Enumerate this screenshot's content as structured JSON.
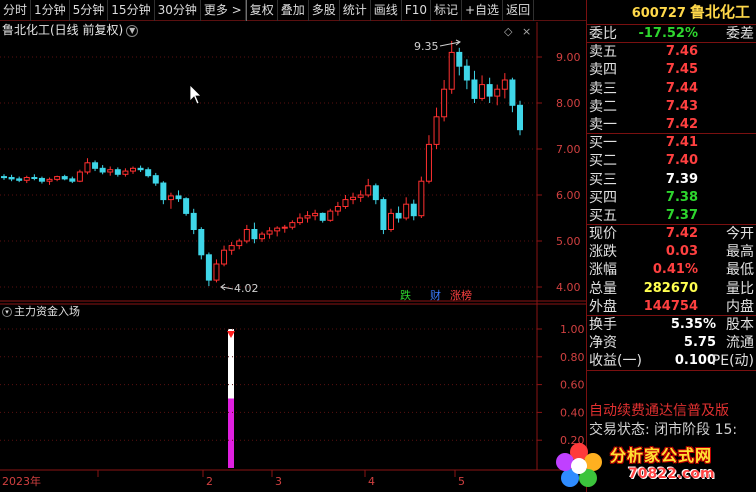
{
  "toolbar": [
    "分时",
    "1分钟",
    "5分钟",
    "15分钟",
    "30分钟",
    "更多 >",
    "复权",
    "叠加",
    "多股",
    "统计",
    "画线",
    "F10",
    "标记",
    "+自选",
    "返回"
  ],
  "chart": {
    "title": "鲁北化工(日线 前复权)",
    "indicator_title": "主力资金入场",
    "high_label": "9.35",
    "low_label": "4.02",
    "year_label": "2023年",
    "month_ticks": [
      "2",
      "3",
      "4",
      "5"
    ],
    "badges": [
      {
        "text": "跌",
        "color": "#2ed62e"
      },
      {
        "text": "财",
        "color": "#3a7cff"
      },
      {
        "text": "涨榜",
        "color": "#ff4040"
      }
    ]
  },
  "chart_data": [
    {
      "type": "candlestick",
      "y_axis_ticks": [
        4.0,
        5.0,
        6.0,
        7.0,
        8.0,
        9.0
      ],
      "ylim": [
        3.95,
        9.55
      ],
      "ohlc": [
        [
          6.4,
          6.45,
          6.33,
          6.38
        ],
        [
          6.38,
          6.44,
          6.3,
          6.35
        ],
        [
          6.35,
          6.4,
          6.28,
          6.32
        ],
        [
          6.32,
          6.42,
          6.26,
          6.38
        ],
        [
          6.38,
          6.45,
          6.32,
          6.36
        ],
        [
          6.36,
          6.4,
          6.25,
          6.3
        ],
        [
          6.3,
          6.38,
          6.22,
          6.34
        ],
        [
          6.34,
          6.42,
          6.3,
          6.4
        ],
        [
          6.4,
          6.44,
          6.32,
          6.35
        ],
        [
          6.35,
          6.4,
          6.26,
          6.3
        ],
        [
          6.3,
          6.55,
          6.28,
          6.5
        ],
        [
          6.5,
          6.8,
          6.45,
          6.7
        ],
        [
          6.7,
          6.75,
          6.52,
          6.58
        ],
        [
          6.58,
          6.65,
          6.45,
          6.5
        ],
        [
          6.5,
          6.62,
          6.42,
          6.55
        ],
        [
          6.55,
          6.6,
          6.4,
          6.45
        ],
        [
          6.45,
          6.58,
          6.4,
          6.52
        ],
        [
          6.52,
          6.62,
          6.46,
          6.58
        ],
        [
          6.58,
          6.64,
          6.5,
          6.55
        ],
        [
          6.55,
          6.6,
          6.38,
          6.42
        ],
        [
          6.42,
          6.48,
          6.2,
          6.26
        ],
        [
          6.26,
          6.3,
          5.8,
          5.9
        ],
        [
          5.9,
          6.05,
          5.7,
          5.98
        ],
        [
          5.98,
          6.1,
          5.85,
          5.92
        ],
        [
          5.92,
          5.95,
          5.55,
          5.6
        ],
        [
          5.6,
          5.7,
          5.15,
          5.25
        ],
        [
          5.25,
          5.3,
          4.6,
          4.7
        ],
        [
          4.7,
          4.75,
          4.02,
          4.15
        ],
        [
          4.15,
          4.6,
          4.1,
          4.5
        ],
        [
          4.5,
          4.9,
          4.45,
          4.8
        ],
        [
          4.8,
          4.98,
          4.7,
          4.9
        ],
        [
          4.9,
          5.05,
          4.82,
          5.0
        ],
        [
          5.0,
          5.35,
          4.95,
          5.25
        ],
        [
          5.25,
          5.4,
          4.95,
          5.05
        ],
        [
          5.05,
          5.2,
          4.98,
          5.15
        ],
        [
          5.15,
          5.3,
          5.05,
          5.22
        ],
        [
          5.22,
          5.32,
          5.1,
          5.28
        ],
        [
          5.28,
          5.35,
          5.18,
          5.3
        ],
        [
          5.3,
          5.45,
          5.25,
          5.4
        ],
        [
          5.4,
          5.6,
          5.35,
          5.5
        ],
        [
          5.5,
          5.65,
          5.4,
          5.55
        ],
        [
          5.55,
          5.68,
          5.45,
          5.6
        ],
        [
          5.6,
          5.62,
          5.4,
          5.45
        ],
        [
          5.45,
          5.7,
          5.42,
          5.65
        ],
        [
          5.65,
          5.85,
          5.55,
          5.75
        ],
        [
          5.75,
          6.0,
          5.7,
          5.9
        ],
        [
          5.9,
          6.05,
          5.8,
          5.95
        ],
        [
          5.95,
          6.1,
          5.85,
          6.0
        ],
        [
          6.0,
          6.35,
          5.95,
          6.2
        ],
        [
          6.2,
          6.25,
          5.8,
          5.9
        ],
        [
          5.9,
          5.95,
          5.15,
          5.25
        ],
        [
          5.25,
          5.7,
          5.2,
          5.6
        ],
        [
          5.6,
          5.75,
          5.4,
          5.5
        ],
        [
          5.5,
          5.95,
          5.45,
          5.8
        ],
        [
          5.8,
          5.9,
          5.45,
          5.55
        ],
        [
          5.55,
          6.4,
          5.5,
          6.3
        ],
        [
          6.3,
          7.3,
          6.25,
          7.1
        ],
        [
          7.1,
          7.9,
          7.0,
          7.7
        ],
        [
          7.7,
          8.5,
          7.6,
          8.3
        ],
        [
          8.3,
          9.35,
          8.2,
          9.1
        ],
        [
          9.1,
          9.2,
          8.6,
          8.8
        ],
        [
          8.8,
          8.95,
          8.3,
          8.5
        ],
        [
          8.5,
          8.7,
          8.0,
          8.1
        ],
        [
          8.1,
          8.6,
          8.05,
          8.4
        ],
        [
          8.4,
          8.55,
          8.0,
          8.15
        ],
        [
          8.15,
          8.4,
          7.95,
          8.3
        ],
        [
          8.3,
          8.65,
          8.1,
          8.5
        ],
        [
          8.5,
          8.55,
          7.8,
          7.95
        ],
        [
          7.95,
          8.05,
          7.3,
          7.42
        ]
      ]
    },
    {
      "type": "bar",
      "series": [
        {
          "values": [
            0.5,
            1.0
          ]
        }
      ],
      "y_axis_ticks": [
        0.2,
        0.4,
        0.6,
        0.8,
        1.0
      ],
      "ylim": [
        0,
        1.05
      ]
    }
  ],
  "panel": {
    "code": "600727",
    "name": "鲁北化工",
    "weibi": {
      "label": "委比",
      "value": "-17.52%",
      "label2": "委差",
      "color": "#2ed62e"
    },
    "asks": [
      {
        "label": "卖五",
        "price": "7.46"
      },
      {
        "label": "卖四",
        "price": "7.45"
      },
      {
        "label": "卖三",
        "price": "7.44"
      },
      {
        "label": "卖二",
        "price": "7.43"
      },
      {
        "label": "卖一",
        "price": "7.42"
      }
    ],
    "bids": [
      {
        "label": "买一",
        "price": "7.41",
        "color": "#ff4040"
      },
      {
        "label": "买二",
        "price": "7.40",
        "color": "#ff4040"
      },
      {
        "label": "买三",
        "price": "7.39",
        "color": "#ffffff"
      },
      {
        "label": "买四",
        "price": "7.38",
        "color": "#2ed62e"
      },
      {
        "label": "买五",
        "price": "7.37",
        "color": "#2ed62e"
      }
    ],
    "quote": [
      {
        "label": "现价",
        "value": "7.42",
        "label2": "今开",
        "color": "#ff4040"
      },
      {
        "label": "涨跌",
        "value": "0.03",
        "label2": "最高",
        "color": "#ff4040"
      },
      {
        "label": "涨幅",
        "value": "0.41%",
        "label2": "最低",
        "color": "#ff4040"
      },
      {
        "label": "总量",
        "value": "282670",
        "label2": "量比",
        "color": "#ffff50"
      },
      {
        "label": "外盘",
        "value": "144754",
        "label2": "内盘",
        "color": "#ff4040"
      }
    ],
    "fin": [
      {
        "label": "换手",
        "value": "5.35%",
        "label2": "股本"
      },
      {
        "label": "净资",
        "value": "5.75",
        "label2": "流通"
      },
      {
        "label": "收益(一)",
        "value": "0.100",
        "label2": "PE(动)"
      }
    ],
    "promo": "自动续费通达信普及版",
    "status": "交易状态: 闭市阶段 15:"
  },
  "watermark": {
    "text": "分析家公式网",
    "url": "70822.com"
  }
}
